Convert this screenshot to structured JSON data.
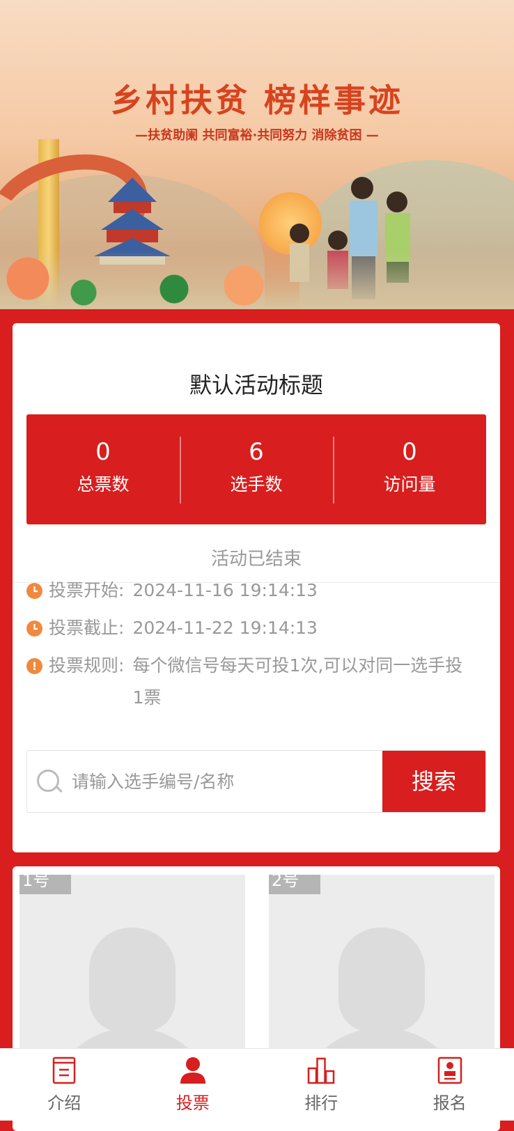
{
  "banner": {
    "title": "乡村扶贫 榜样事迹",
    "subtitle": "—扶贫助阑 共同富裕·共同努力 消除贫困 —"
  },
  "activity": {
    "title": "默认活动标题",
    "stats": [
      {
        "value": "0",
        "label": "总票数"
      },
      {
        "value": "6",
        "label": "选手数"
      },
      {
        "value": "0",
        "label": "访问量"
      }
    ],
    "status": "活动已结束",
    "start_label": "投票开始:",
    "start_value": "2024-11-16 19:14:13",
    "end_label": "投票截止:",
    "end_value": "2024-11-22 19:14:13",
    "rule_label": "投票规则:",
    "rule_value": "每个微信号每天可投1次,可以对同一选手投1票"
  },
  "search": {
    "placeholder": "请输入选手编号/名称",
    "button_label": "搜索"
  },
  "candidates": [
    {
      "badge": "1号"
    },
    {
      "badge": "2号"
    }
  ],
  "tabbar": {
    "items": [
      {
        "label": "介绍",
        "icon": "document-icon"
      },
      {
        "label": "投票",
        "icon": "user-icon"
      },
      {
        "label": "排行",
        "icon": "bar-chart-icon"
      },
      {
        "label": "报名",
        "icon": "id-card-icon"
      }
    ],
    "active_index": 1
  },
  "colors": {
    "primary": "#d81e1e",
    "info_icon": "#f0893e"
  }
}
